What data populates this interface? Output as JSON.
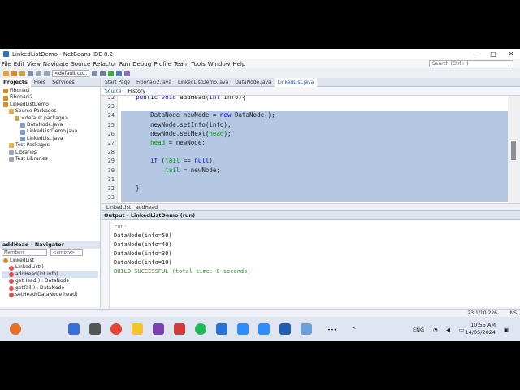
{
  "window": {
    "title": "LinkedListDemo - NetBeans IDE 8.2",
    "controls": [
      "–",
      "□",
      "✕"
    ]
  },
  "menu": [
    "File",
    "Edit",
    "View",
    "Navigate",
    "Source",
    "Refactor",
    "Run",
    "Debug",
    "Profile",
    "Team",
    "Tools",
    "Window",
    "Help"
  ],
  "search": {
    "placeholder": "Search (Ctrl+I)"
  },
  "toolbar": {
    "config": "<default co..."
  },
  "left_panel": {
    "tabs": [
      "Projects",
      "Files",
      "Services"
    ],
    "tree": [
      {
        "label": "Fibonaci",
        "depth": 0,
        "color": "#d98b2b"
      },
      {
        "label": "Fibonaci2",
        "depth": 0,
        "color": "#d98b2b"
      },
      {
        "label": "LinkedListDemo",
        "depth": 0,
        "color": "#d98b2b"
      },
      {
        "label": "Source Packages",
        "depth": 1,
        "color": "#e0b040"
      },
      {
        "label": "<default package>",
        "depth": 2,
        "color": "#c6a85a"
      },
      {
        "label": "DataNode.java",
        "depth": 3,
        "color": "#7a9ccf"
      },
      {
        "label": "LinkedListDemo.java",
        "depth": 3,
        "color": "#7a9ccf"
      },
      {
        "label": "LinkedList.java",
        "depth": 3,
        "color": "#7a9ccf"
      },
      {
        "label": "Test Packages",
        "depth": 1,
        "color": "#e0b040"
      },
      {
        "label": "Libraries",
        "depth": 1,
        "color": "#9aa6b8"
      },
      {
        "label": "Test Libraries",
        "depth": 1,
        "color": "#9aa6b8"
      }
    ]
  },
  "navigator": {
    "title": "addHead - Navigator",
    "filter_left": "Members",
    "filter_right": "<empty>",
    "items": [
      {
        "label": "LinkedList"
      },
      {
        "label": "LinkedList()"
      },
      {
        "label": "addHead(int info)"
      },
      {
        "label": "getHead() : DataNode"
      },
      {
        "label": "getTail() : DataNode"
      },
      {
        "label": "setHead(DataNode head)"
      }
    ]
  },
  "editor": {
    "tabs": [
      "Start Page",
      "Fibonaci2.java",
      "LinkedListDemo.java",
      "DataNode.java",
      "LinkedList.java"
    ],
    "active_tab": "LinkedList.java",
    "subtabs": [
      "Source",
      "History"
    ],
    "lines": [
      {
        "num": "22",
        "code": "    public void addHead(int info){"
      },
      {
        "num": "23",
        "code": ""
      },
      {
        "num": "24",
        "code": "        DataNode newNode = new DataNode();"
      },
      {
        "num": "25",
        "code": "        newNode.setInfo(info);"
      },
      {
        "num": "26",
        "code": "        newNode.setNext(head);"
      },
      {
        "num": "27",
        "code": "        head = newNode;"
      },
      {
        "num": "28",
        "code": ""
      },
      {
        "num": "29",
        "code": "        if (tail == null)"
      },
      {
        "num": "30",
        "code": "            tail = newNode;"
      },
      {
        "num": "31",
        "code": ""
      },
      {
        "num": "32",
        "code": "    }"
      },
      {
        "num": "33",
        "code": ""
      }
    ],
    "breadcrumbs": [
      "LinkedList",
      "addHead"
    ]
  },
  "output": {
    "title": "Output - LinkedListDemo (run)",
    "lines": [
      {
        "text": "run:",
        "color": "#777777"
      },
      {
        "text": "DataNode(info=50)",
        "color": "#222222"
      },
      {
        "text": "DataNode(info=40)",
        "color": "#222222"
      },
      {
        "text": "DataNode(info=30)",
        "color": "#222222"
      },
      {
        "text": "DataNode(info=10)",
        "color": "#222222"
      },
      {
        "text": "BUILD SUCCESSFUL (total time: 0 seconds)",
        "color": "#2e8b2e"
      }
    ]
  },
  "status": {
    "position": "23:1/10:226",
    "mode": "INS"
  },
  "taskbar": {
    "language": "ENG",
    "time": "10:55 AM",
    "date": "14/05/2024"
  }
}
